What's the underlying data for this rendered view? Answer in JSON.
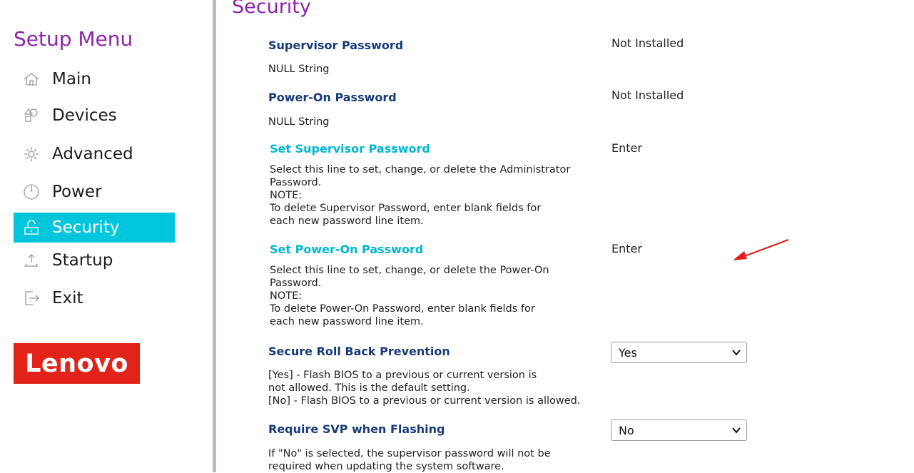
{
  "sidebar": {
    "title": "Setup Menu",
    "items": [
      {
        "label": "Main",
        "icon": "home-icon"
      },
      {
        "label": "Devices",
        "icon": "devices-icon"
      },
      {
        "label": "Advanced",
        "icon": "advanced-icon"
      },
      {
        "label": "Power",
        "icon": "power-icon"
      },
      {
        "label": "Security",
        "icon": "security-icon",
        "active": true
      },
      {
        "label": "Startup",
        "icon": "startup-icon"
      },
      {
        "label": "Exit",
        "icon": "exit-icon"
      }
    ],
    "logo": "Lenovo"
  },
  "main": {
    "title": "Security",
    "items": [
      {
        "label": "Supervisor Password",
        "value": "Not Installed",
        "desc": "NULL String"
      },
      {
        "label": "Power-On Password",
        "value": "Not Installed",
        "desc": "NULL String"
      },
      {
        "label": "Set Supervisor Password",
        "value": "Enter",
        "desc": "Select this line to set, change, or delete the Administrator\nPassword.\nNOTE:\nTo delete Supervisor Password, enter blank fields for\neach new password line item."
      },
      {
        "label": "Set Power-On Password",
        "value": "Enter",
        "desc": "Select this line to set, change, or delete the Power-On\nPassword.\nNOTE:\nTo delete Power-On Password, enter blank fields for\neach new password line item."
      },
      {
        "label": "Secure Roll Back Prevention",
        "value": "Yes",
        "desc": "[Yes] - Flash BIOS to a previous or current version is\nnot allowed. This is the default setting.\n[No] - Flash BIOS to a previous or current version is allowed."
      },
      {
        "label": "Require SVP when Flashing",
        "value": "No",
        "desc": "If \"No\" is selected, the supervisor password will not be\nrequired when updating the system software."
      }
    ]
  },
  "colors": {
    "accent_purple": "#8e24aa",
    "active_cyan": "#00c6dc",
    "label_blue": "#173a7a",
    "link_cyan": "#00b7d0",
    "logo_red": "#e2231a",
    "annotation_red": "#e81c1c"
  }
}
